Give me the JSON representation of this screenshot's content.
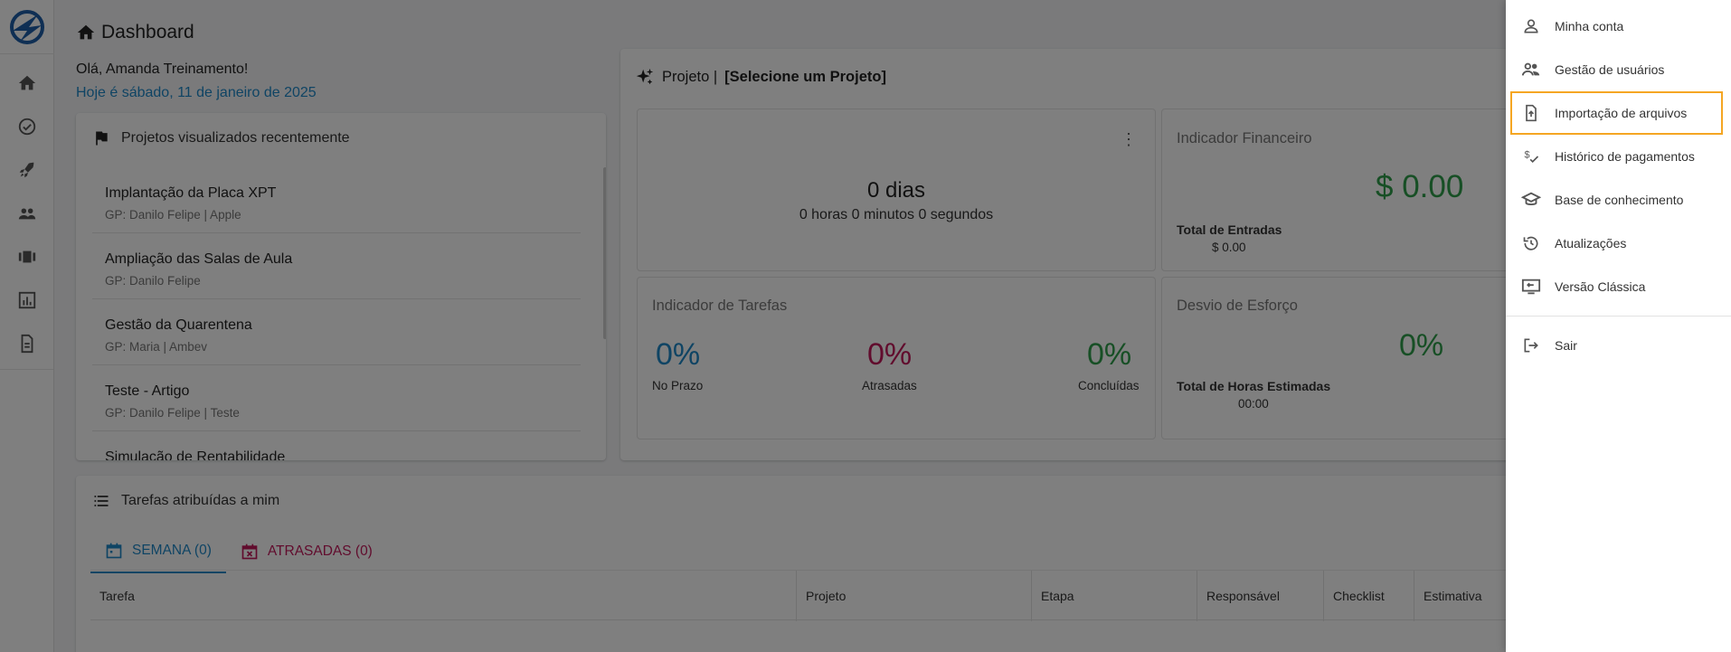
{
  "page": {
    "title": "Dashboard",
    "greeting": "Olá, Amanda Treinamento!",
    "date_line": "Hoje é sábado, 11 de janeiro de 2025"
  },
  "rail": {
    "logo": "logo-icon",
    "items": [
      "home-icon",
      "check-circle-icon",
      "rocket-icon",
      "people-icon",
      "view-carousel-icon",
      "bar-chart-icon",
      "document-icon"
    ]
  },
  "recent": {
    "title": "Projetos visualizados recentemente",
    "items": [
      {
        "name": "Implantação da Placa XPT",
        "sub": "GP: Danilo Felipe | Apple"
      },
      {
        "name": "Ampliação das Salas de Aula",
        "sub": "GP: Danilo Felipe"
      },
      {
        "name": "Gestão da Quarentena",
        "sub": "GP: Maria | Ambev"
      },
      {
        "name": "Teste - Artigo",
        "sub": "GP: Danilo Felipe | Teste"
      },
      {
        "name": "Simulação de Rentabilidade",
        "sub": ""
      }
    ]
  },
  "project": {
    "prefix": "Projeto |",
    "selection": "[Selecione um Projeto]",
    "days": {
      "big": "0 dias",
      "small": "0 horas 0 minutos 0 segundos"
    },
    "financeiro": {
      "label": "Indicador Financeiro",
      "value": "$ 0.00",
      "entradas_label": "Total de Entradas",
      "entradas_value": "$ 0.00"
    },
    "tarefas": {
      "label": "Indicador de Tarefas",
      "items": [
        {
          "pct": "0%",
          "label": "No Prazo",
          "color": "#1e88c8"
        },
        {
          "pct": "0%",
          "label": "Atrasadas",
          "color": "#c2185b"
        },
        {
          "pct": "0%",
          "label": "Concluídas",
          "color": "#2e9e4a"
        }
      ]
    },
    "desvio": {
      "label": "Desvio de Esforço",
      "pct": "0%",
      "horas_label": "Total de Horas Estimadas",
      "horas_value": "00:00"
    }
  },
  "tasks": {
    "title": "Tarefas atribuídas a mim",
    "tabs": [
      {
        "label": "SEMANA (0)",
        "icon": "calendar-icon"
      },
      {
        "label": "ATRASADAS (0)",
        "icon": "calendar-late-icon"
      }
    ],
    "columns": [
      "Tarefa",
      "Projeto",
      "Etapa",
      "Responsável",
      "Checklist",
      "Estimativa"
    ]
  },
  "menu": {
    "items": [
      {
        "label": "Minha conta",
        "icon": "person-icon"
      },
      {
        "label": "Gestão de usuários",
        "icon": "manage-users-icon"
      },
      {
        "label": "Importação de arquivos",
        "icon": "file-upload-icon"
      },
      {
        "label": "Histórico de pagamentos",
        "icon": "payment-history-icon"
      },
      {
        "label": "Base de conhecimento",
        "icon": "school-icon"
      },
      {
        "label": "Atualizações",
        "icon": "history-icon"
      },
      {
        "label": "Versão Clássica",
        "icon": "classic-version-icon"
      }
    ],
    "logout": {
      "label": "Sair",
      "icon": "logout-icon"
    }
  },
  "colors": {
    "accent": "#1e88c8",
    "late": "#c2185b",
    "success": "#2e9e4a",
    "highlight": "#f5a623"
  }
}
